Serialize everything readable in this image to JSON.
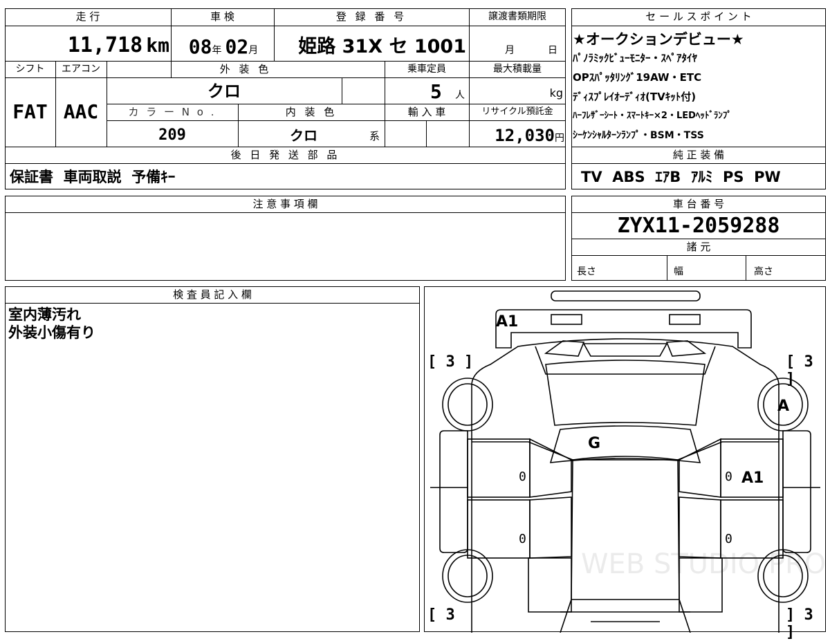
{
  "top_labels": {
    "mileage": "走 行",
    "inspection": "車 検",
    "registration": "登 録 番 号",
    "transfer_deadline": "譲渡書類期限",
    "shift": "シフト",
    "aircon": "エアコン",
    "exterior_color": "外 装 色",
    "capacity": "乗車定員",
    "max_load": "最大積載量",
    "color_no": "カ ラ ー N o .",
    "interior_color": "内 装 色",
    "import": "輸 入 車",
    "recycle": "リサイクル預託金",
    "later_parts": "後 日 発 送 部 品"
  },
  "values": {
    "mileage": "11,718",
    "mileage_unit": "km",
    "inspection_year": "08",
    "inspection_year_unit": "年",
    "inspection_month": "02",
    "inspection_month_unit": "月",
    "registration": "姫路 31X セ 1001",
    "deadline_month": "月",
    "deadline_day": "日",
    "shift": "FAT",
    "aircon": "AAC",
    "exterior_color": "クロ",
    "capacity": "5",
    "capacity_unit": "人",
    "max_load_unit": "kg",
    "color_no": "209",
    "interior_color": "クロ",
    "interior_suffix": "系",
    "recycle": "12,030",
    "recycle_unit": "円",
    "later_parts": "保証書  車両取説  予備ｷｰ"
  },
  "sales": {
    "header": "セ ー ル ス ポ イ ン ト",
    "lines": [
      "★オークションデビュー★",
      "ﾊﾟﾉﾗﾐｯｸﾋﾞｭｰﾓﾆﾀｰ・ｽﾍﾟｱﾀｲﾔ",
      "OPｽﾊﾟｯﾀﾘﾝｸﾞ19AW・ETC",
      "ﾃﾞｨｽﾌﾟﾚｲｵｰﾃﾞｨｵ(TVｷｯﾄ付)",
      "ﾊｰﾌﾚｻﾞｰｼｰﾄ・ｽﾏｰﾄｷｰ×2・LEDﾍｯﾄﾞﾗﾝﾌﾟ",
      "ｼｰｹﾝｼｬﾙﾀｰﾝﾗﾝﾌﾟ・BSM・TSS"
    ]
  },
  "equipment": {
    "header": "純 正 装 備",
    "value": "TV  ABS  ｴｱB  ｱﾙﾐ  PS  PW"
  },
  "notes": {
    "header": "注 意 事 項 欄"
  },
  "chassis": {
    "header": "車 台 番 号",
    "value": "ZYX11-2059288",
    "spec_header": "諸 元",
    "length": "長さ",
    "width": "幅",
    "height": "高さ"
  },
  "inspector": {
    "header": "検 査 員 記 入 欄",
    "lines": [
      "室内薄汚れ",
      "外装小傷有り"
    ]
  },
  "diagram": {
    "marks": {
      "rear": "A1",
      "right_rear_wheel": "A",
      "roof": "G",
      "right_door": "A1",
      "tire_tl": "[ 3 ]",
      "tire_tr": "[ 3 ]",
      "tire_bl": "[ 3",
      "tire_br": "] 3 ]",
      "door_lf": "0",
      "door_lr": "0",
      "door_rf": "0",
      "door_rr": "0"
    },
    "watermark": "WEB STUDIO PRO"
  }
}
